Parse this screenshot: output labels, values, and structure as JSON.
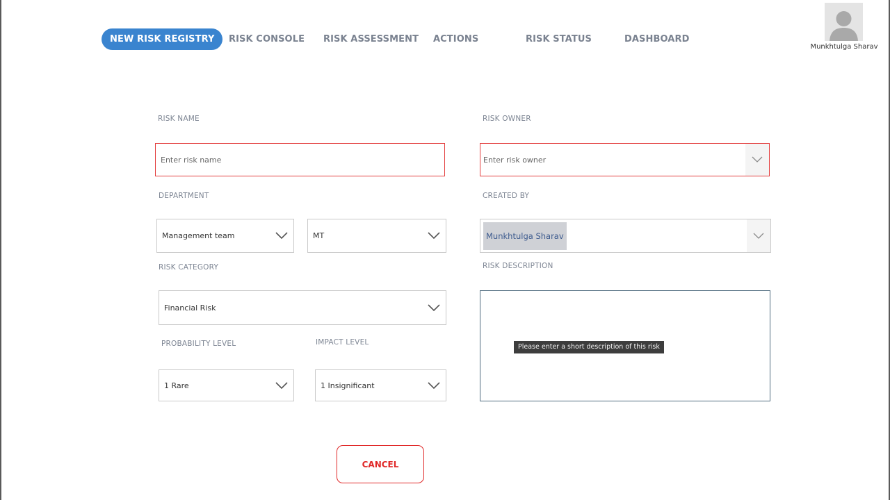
{
  "nav": {
    "tabs": [
      {
        "label": "NEW RISK REGISTRY",
        "active": true
      },
      {
        "label": "RISK CONSOLE"
      },
      {
        "label": "RISK ASSESSMENT"
      },
      {
        "label": "ACTIONS"
      },
      {
        "label": "RISK STATUS"
      },
      {
        "label": "DASHBOARD"
      }
    ],
    "accent_color": "#3a84cf"
  },
  "user": {
    "name": "Munkhtulga Sharav"
  },
  "form": {
    "risk_name": {
      "label": "RISK NAME",
      "placeholder": "Enter risk name"
    },
    "risk_owner": {
      "label": "RISK OWNER",
      "placeholder": "Enter risk owner"
    },
    "department": {
      "label": "DEPARTMENT",
      "value": "Management team",
      "code": "MT"
    },
    "created_by": {
      "label": "CREATED BY",
      "value": "Munkhtulga Sharav"
    },
    "risk_category": {
      "label": "RISK CATEGORY",
      "value": "Financial Risk"
    },
    "risk_description": {
      "label": "RISK DESCRIPTION",
      "tooltip": "Please enter a short description of this risk"
    },
    "probability_level": {
      "label": "PROBABILITY LEVEL",
      "value": "1 Rare"
    },
    "impact_level": {
      "label": "IMPACT LEVEL",
      "value": "1 Insignificant"
    },
    "validation_color": "#e33e3e"
  },
  "actions": {
    "cancel_label": "CANCEL",
    "cancel_color": "#e02828"
  }
}
